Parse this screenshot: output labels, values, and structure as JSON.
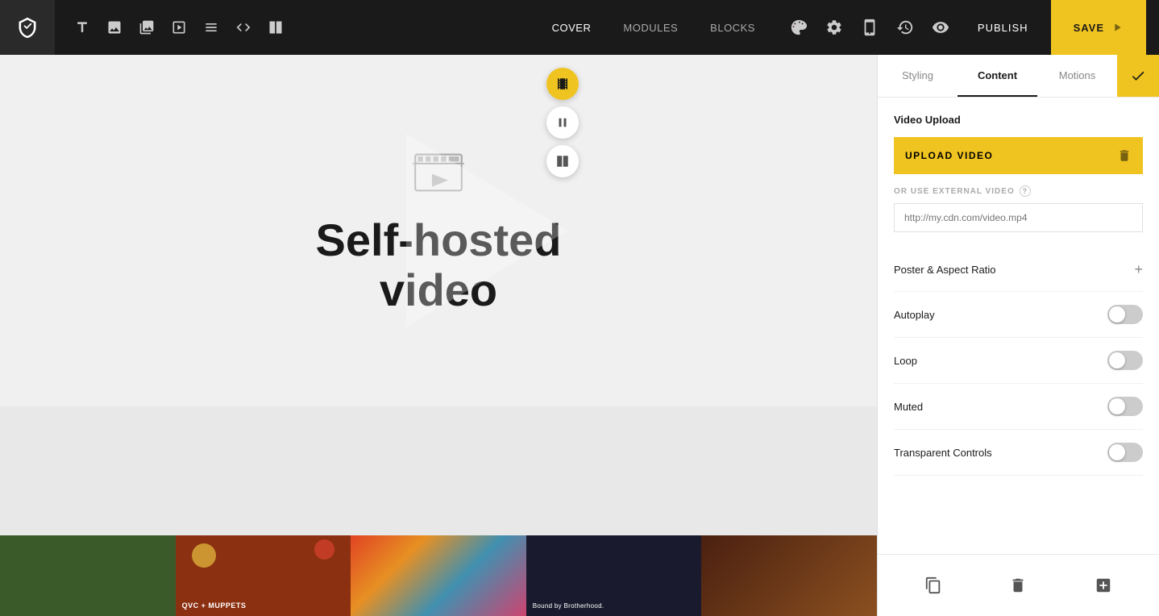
{
  "navbar": {
    "logo_alt": "Logo",
    "nav_links": [
      {
        "id": "cover",
        "label": "COVER",
        "active": true
      },
      {
        "id": "modules",
        "label": "MODULES",
        "active": false
      },
      {
        "id": "blocks",
        "label": "BLOCKS",
        "active": false
      }
    ],
    "publish_label": "PUBLISH",
    "save_label": "SAVE"
  },
  "tools": [
    {
      "id": "text",
      "icon": "T"
    },
    {
      "id": "image",
      "icon": "img"
    },
    {
      "id": "gallery",
      "icon": "gallery"
    },
    {
      "id": "slideshow",
      "icon": "slideshow"
    },
    {
      "id": "layout",
      "icon": "layout"
    },
    {
      "id": "embed",
      "icon": "embed"
    },
    {
      "id": "columns",
      "icon": "columns"
    }
  ],
  "canvas": {
    "video_title_line1": "Self-hosted",
    "video_title_line2": "video"
  },
  "right_tools": [
    {
      "id": "video",
      "active": true
    },
    {
      "id": "pause",
      "active": false
    },
    {
      "id": "split",
      "active": false
    }
  ],
  "thumbnails": [
    {
      "id": "thumb-1",
      "label": "",
      "color": "#2d4a1e"
    },
    {
      "id": "thumb-2",
      "label": "QVC + MUPPETS",
      "color": "#8b3010"
    },
    {
      "id": "thumb-3",
      "label": "",
      "color": "#d4502a"
    },
    {
      "id": "thumb-4",
      "label": "Bound by Brotherhood.",
      "color": "#1a1a2e"
    },
    {
      "id": "thumb-5",
      "label": "",
      "color": "#2a1a10"
    }
  ],
  "panel": {
    "tabs": [
      {
        "id": "styling",
        "label": "Styling",
        "active": false
      },
      {
        "id": "content",
        "label": "Content",
        "active": true
      },
      {
        "id": "motions",
        "label": "Motions",
        "active": false
      }
    ],
    "confirm_icon": "✓",
    "sections": {
      "video_upload": {
        "title": "Video Upload",
        "upload_btn_label": "UPLOAD VIDEO",
        "external_video_label": "OR USE EXTERNAL VIDEO",
        "url_placeholder": "http://my.cdn.com/video.mp4"
      },
      "poster_aspect": {
        "label": "Poster & Aspect Ratio"
      },
      "autoplay": {
        "label": "Autoplay",
        "enabled": false
      },
      "loop": {
        "label": "Loop",
        "enabled": false
      },
      "muted": {
        "label": "Muted",
        "enabled": false
      },
      "transparent_controls": {
        "label": "Transparent Controls",
        "enabled": false
      }
    },
    "footer": {
      "duplicate_icon": "duplicate",
      "trash_icon": "trash",
      "add_icon": "add"
    }
  }
}
